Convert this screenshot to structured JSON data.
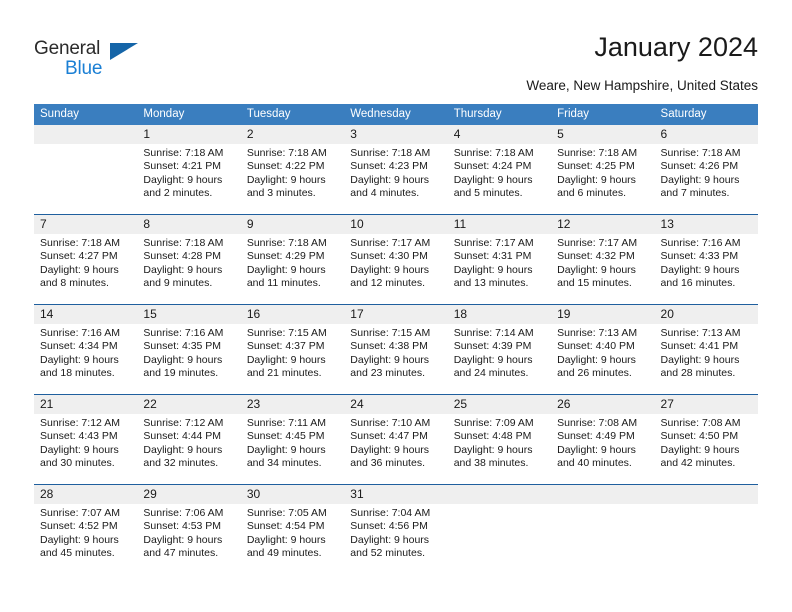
{
  "brand": {
    "name_top": "General",
    "name_bottom": "Blue",
    "color_dark": "#2b2b2b",
    "color_blue": "#1a7fd4",
    "triangle_color": "#1565a8"
  },
  "header": {
    "title": "January 2024",
    "subtitle": "Weare, New Hampshire, United States"
  },
  "theme": {
    "header_row_bg": "#3a7ebf",
    "header_row_text": "#ffffff",
    "daynum_bg": "#efefef",
    "week_separator": "#1f5f9e",
    "body_text": "#1a1a1a"
  },
  "weekdays": [
    "Sunday",
    "Monday",
    "Tuesday",
    "Wednesday",
    "Thursday",
    "Friday",
    "Saturday"
  ],
  "weeks": [
    {
      "days": [
        {
          "num": "",
          "lines": []
        },
        {
          "num": "1",
          "lines": [
            "Sunrise: 7:18 AM",
            "Sunset: 4:21 PM",
            "Daylight: 9 hours",
            "and 2 minutes."
          ]
        },
        {
          "num": "2",
          "lines": [
            "Sunrise: 7:18 AM",
            "Sunset: 4:22 PM",
            "Daylight: 9 hours",
            "and 3 minutes."
          ]
        },
        {
          "num": "3",
          "lines": [
            "Sunrise: 7:18 AM",
            "Sunset: 4:23 PM",
            "Daylight: 9 hours",
            "and 4 minutes."
          ]
        },
        {
          "num": "4",
          "lines": [
            "Sunrise: 7:18 AM",
            "Sunset: 4:24 PM",
            "Daylight: 9 hours",
            "and 5 minutes."
          ]
        },
        {
          "num": "5",
          "lines": [
            "Sunrise: 7:18 AM",
            "Sunset: 4:25 PM",
            "Daylight: 9 hours",
            "and 6 minutes."
          ]
        },
        {
          "num": "6",
          "lines": [
            "Sunrise: 7:18 AM",
            "Sunset: 4:26 PM",
            "Daylight: 9 hours",
            "and 7 minutes."
          ]
        }
      ]
    },
    {
      "days": [
        {
          "num": "7",
          "lines": [
            "Sunrise: 7:18 AM",
            "Sunset: 4:27 PM",
            "Daylight: 9 hours",
            "and 8 minutes."
          ]
        },
        {
          "num": "8",
          "lines": [
            "Sunrise: 7:18 AM",
            "Sunset: 4:28 PM",
            "Daylight: 9 hours",
            "and 9 minutes."
          ]
        },
        {
          "num": "9",
          "lines": [
            "Sunrise: 7:18 AM",
            "Sunset: 4:29 PM",
            "Daylight: 9 hours",
            "and 11 minutes."
          ]
        },
        {
          "num": "10",
          "lines": [
            "Sunrise: 7:17 AM",
            "Sunset: 4:30 PM",
            "Daylight: 9 hours",
            "and 12 minutes."
          ]
        },
        {
          "num": "11",
          "lines": [
            "Sunrise: 7:17 AM",
            "Sunset: 4:31 PM",
            "Daylight: 9 hours",
            "and 13 minutes."
          ]
        },
        {
          "num": "12",
          "lines": [
            "Sunrise: 7:17 AM",
            "Sunset: 4:32 PM",
            "Daylight: 9 hours",
            "and 15 minutes."
          ]
        },
        {
          "num": "13",
          "lines": [
            "Sunrise: 7:16 AM",
            "Sunset: 4:33 PM",
            "Daylight: 9 hours",
            "and 16 minutes."
          ]
        }
      ]
    },
    {
      "days": [
        {
          "num": "14",
          "lines": [
            "Sunrise: 7:16 AM",
            "Sunset: 4:34 PM",
            "Daylight: 9 hours",
            "and 18 minutes."
          ]
        },
        {
          "num": "15",
          "lines": [
            "Sunrise: 7:16 AM",
            "Sunset: 4:35 PM",
            "Daylight: 9 hours",
            "and 19 minutes."
          ]
        },
        {
          "num": "16",
          "lines": [
            "Sunrise: 7:15 AM",
            "Sunset: 4:37 PM",
            "Daylight: 9 hours",
            "and 21 minutes."
          ]
        },
        {
          "num": "17",
          "lines": [
            "Sunrise: 7:15 AM",
            "Sunset: 4:38 PM",
            "Daylight: 9 hours",
            "and 23 minutes."
          ]
        },
        {
          "num": "18",
          "lines": [
            "Sunrise: 7:14 AM",
            "Sunset: 4:39 PM",
            "Daylight: 9 hours",
            "and 24 minutes."
          ]
        },
        {
          "num": "19",
          "lines": [
            "Sunrise: 7:13 AM",
            "Sunset: 4:40 PM",
            "Daylight: 9 hours",
            "and 26 minutes."
          ]
        },
        {
          "num": "20",
          "lines": [
            "Sunrise: 7:13 AM",
            "Sunset: 4:41 PM",
            "Daylight: 9 hours",
            "and 28 minutes."
          ]
        }
      ]
    },
    {
      "days": [
        {
          "num": "21",
          "lines": [
            "Sunrise: 7:12 AM",
            "Sunset: 4:43 PM",
            "Daylight: 9 hours",
            "and 30 minutes."
          ]
        },
        {
          "num": "22",
          "lines": [
            "Sunrise: 7:12 AM",
            "Sunset: 4:44 PM",
            "Daylight: 9 hours",
            "and 32 minutes."
          ]
        },
        {
          "num": "23",
          "lines": [
            "Sunrise: 7:11 AM",
            "Sunset: 4:45 PM",
            "Daylight: 9 hours",
            "and 34 minutes."
          ]
        },
        {
          "num": "24",
          "lines": [
            "Sunrise: 7:10 AM",
            "Sunset: 4:47 PM",
            "Daylight: 9 hours",
            "and 36 minutes."
          ]
        },
        {
          "num": "25",
          "lines": [
            "Sunrise: 7:09 AM",
            "Sunset: 4:48 PM",
            "Daylight: 9 hours",
            "and 38 minutes."
          ]
        },
        {
          "num": "26",
          "lines": [
            "Sunrise: 7:08 AM",
            "Sunset: 4:49 PM",
            "Daylight: 9 hours",
            "and 40 minutes."
          ]
        },
        {
          "num": "27",
          "lines": [
            "Sunrise: 7:08 AM",
            "Sunset: 4:50 PM",
            "Daylight: 9 hours",
            "and 42 minutes."
          ]
        }
      ]
    },
    {
      "days": [
        {
          "num": "28",
          "lines": [
            "Sunrise: 7:07 AM",
            "Sunset: 4:52 PM",
            "Daylight: 9 hours",
            "and 45 minutes."
          ]
        },
        {
          "num": "29",
          "lines": [
            "Sunrise: 7:06 AM",
            "Sunset: 4:53 PM",
            "Daylight: 9 hours",
            "and 47 minutes."
          ]
        },
        {
          "num": "30",
          "lines": [
            "Sunrise: 7:05 AM",
            "Sunset: 4:54 PM",
            "Daylight: 9 hours",
            "and 49 minutes."
          ]
        },
        {
          "num": "31",
          "lines": [
            "Sunrise: 7:04 AM",
            "Sunset: 4:56 PM",
            "Daylight: 9 hours",
            "and 52 minutes."
          ]
        },
        {
          "num": "",
          "lines": []
        },
        {
          "num": "",
          "lines": []
        },
        {
          "num": "",
          "lines": []
        }
      ]
    }
  ]
}
